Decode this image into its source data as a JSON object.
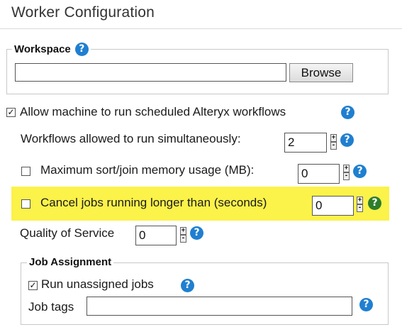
{
  "page": {
    "title": "Worker Configuration"
  },
  "workspace": {
    "legend": "Workspace",
    "path_value": "",
    "browse_label": "Browse"
  },
  "allow_scheduled": {
    "label": "Allow machine to run scheduled Alteryx workflows",
    "checked_mark": "✓"
  },
  "simultaneous": {
    "label": "Workflows allowed to run simultaneously:",
    "value": "2"
  },
  "max_memory": {
    "label": "Maximum sort/join memory usage (MB):",
    "value": "0"
  },
  "cancel_jobs": {
    "label": "Cancel jobs running longer than (seconds)",
    "value": "0"
  },
  "quality": {
    "label": "Quality of Service",
    "value": "0"
  },
  "job_assignment": {
    "legend": "Job Assignment",
    "run_unassigned_label": "Run unassigned jobs",
    "checked_mark": "✓",
    "job_tags_label": "Job tags",
    "job_tags_value": ""
  },
  "spinner": {
    "up": "+",
    "down": "-"
  },
  "help_glyph": "?",
  "colors": {
    "help_blue": "#1f7fd0",
    "help_green": "#2d7d2d",
    "highlight": "#fbf24a"
  }
}
